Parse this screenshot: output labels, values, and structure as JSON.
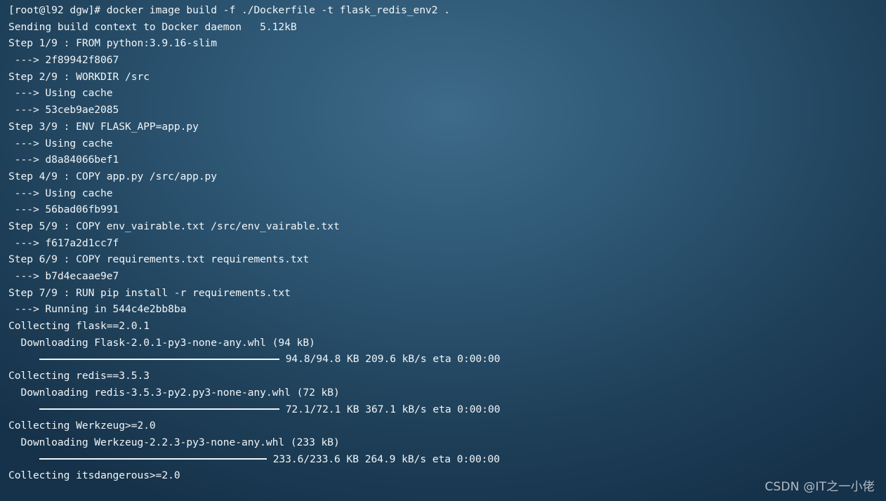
{
  "terminal": {
    "lines": [
      "[root@l92 dgw]# docker image build -f ./Dockerfile -t flask_redis_env2 .",
      "Sending build context to Docker daemon   5.12kB",
      "Step 1/9 : FROM python:3.9.16-slim",
      " ---> 2f89942f8067",
      "Step 2/9 : WORKDIR /src",
      " ---> Using cache",
      " ---> 53ceb9ae2085",
      "Step 3/9 : ENV FLASK_APP=app.py",
      " ---> Using cache",
      " ---> d8a84066bef1",
      "Step 4/9 : COPY app.py /src/app.py",
      " ---> Using cache",
      " ---> 56bad06fb991",
      "Step 5/9 : COPY env_vairable.txt /src/env_vairable.txt",
      " ---> f617a2d1cc7f",
      "Step 6/9 : COPY requirements.txt requirements.txt",
      " ---> b7d4ecaae9e7",
      "Step 7/9 : RUN pip install -r requirements.txt",
      " ---> Running in 544c4e2bb8ba",
      "Collecting flask==2.0.1",
      "  Downloading Flask-2.0.1-py3-none-any.whl (94 kB)"
    ],
    "progress_1": "94.8/94.8 KB 209.6 kB/s eta 0:00:00",
    "lines_b": [
      "Collecting redis==3.5.3",
      "  Downloading redis-3.5.3-py2.py3-none-any.whl (72 kB)"
    ],
    "progress_2": "72.1/72.1 KB 367.1 kB/s eta 0:00:00",
    "lines_c": [
      "Collecting Werkzeug>=2.0",
      "  Downloading Werkzeug-2.2.3-py3-none-any.whl (233 kB)"
    ],
    "progress_3": "233.6/233.6 KB 264.9 kB/s eta 0:00:00",
    "last_line": "Collecting itsdangerous>=2.0"
  },
  "watermark": "CSDN @IT之一小佬",
  "colors": {
    "text": "#f2f5f7",
    "background": "#2d5673"
  }
}
